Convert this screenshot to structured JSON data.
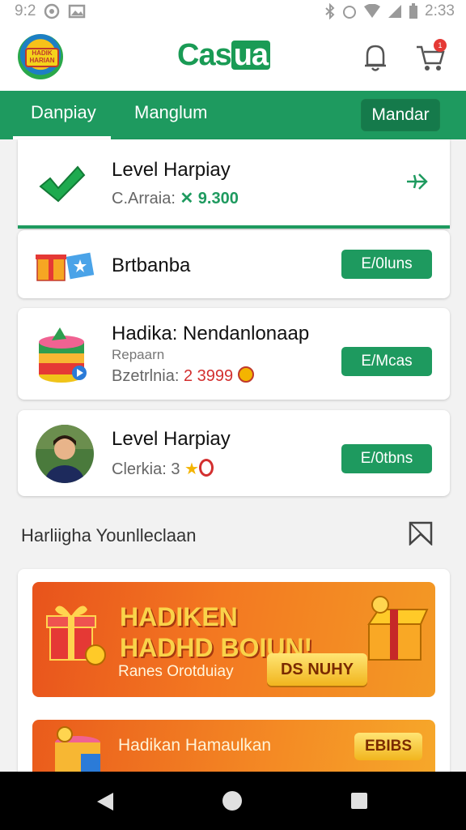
{
  "status_bar": {
    "time_left": "9:2",
    "time_right": "2:33"
  },
  "header": {
    "logo_text": "HADIK HARIAN",
    "brand_prefix": "Cas",
    "brand_boxed": "ua",
    "cart_badge": "1"
  },
  "tabs": {
    "tab1": "Danpiay",
    "tab2": "Manglum",
    "button": "Mandar"
  },
  "cards": [
    {
      "title": "Level Harpiay",
      "sub_label": "C.Arraia:",
      "sub_value": "9.300",
      "action": ""
    },
    {
      "title": "Brtbanba",
      "action": "E/0luns"
    },
    {
      "title": "Hadika: Nendanlonaap",
      "subtitle": "Repaarn",
      "sub_label": "Bzetrlnia:",
      "sub_value": "2 3999",
      "action": "E/Mcas"
    },
    {
      "title": "Level Harpiay",
      "sub_label": "Clerkia:",
      "sub_value": "3",
      "action": "E/0tbns"
    }
  ],
  "section": {
    "title": "Harliigha Younlleclaan"
  },
  "promos": {
    "banner1_line1": "HADIKEN",
    "banner1_line2": "HADHD BOIUN!",
    "banner1_tag": "Ranes Orotduiay",
    "banner1_button": "DS NUHY",
    "banner2_text": "Hadikan Hamaulkan",
    "banner2_button": "EBIBS"
  },
  "colors": {
    "primary_green": "#1e9a5f",
    "promo_orange": "#f37821",
    "accent_red": "#d32f2f"
  }
}
